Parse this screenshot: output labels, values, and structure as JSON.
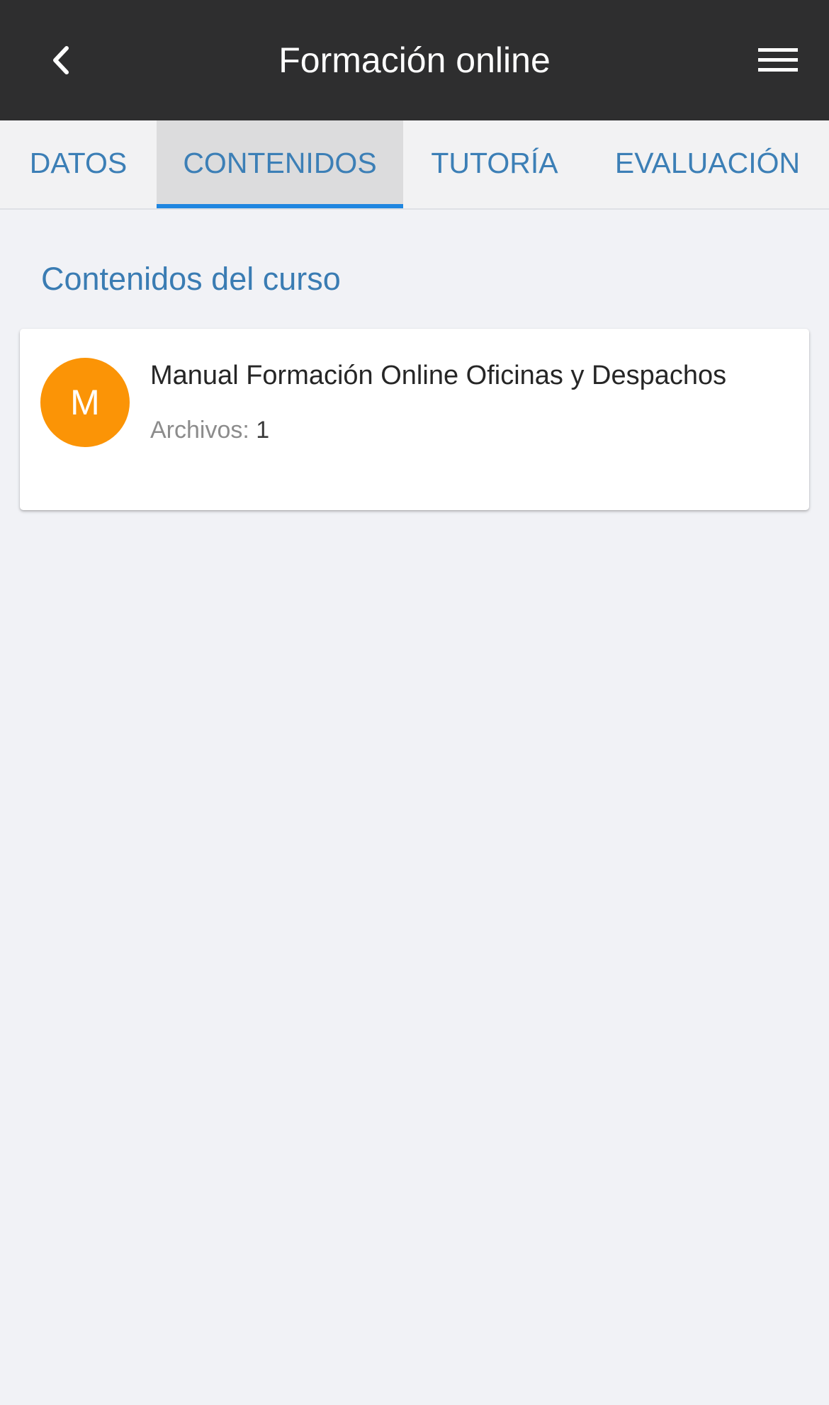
{
  "header": {
    "title": "Formación online",
    "back_icon": "chevron-left-icon",
    "menu_icon": "hamburger-menu-icon"
  },
  "tabs": [
    {
      "label": "DATOS",
      "active": false
    },
    {
      "label": "CONTENIDOS",
      "active": true
    },
    {
      "label": "TUTORÍA",
      "active": false
    },
    {
      "label": "EVALUACIÓN",
      "active": false
    }
  ],
  "main": {
    "section_title": "Contenidos del curso",
    "items": [
      {
        "avatar_letter": "M",
        "title": "Manual Formación Online Oficinas y Despachos",
        "files_label": "Archivos:",
        "files_count": "1"
      }
    ]
  },
  "colors": {
    "appbar": "#2e2e2f",
    "accent": "#1f86e0",
    "tab_text": "#3c7fb6",
    "avatar": "#fb9406",
    "background": "#f1f2f6"
  }
}
